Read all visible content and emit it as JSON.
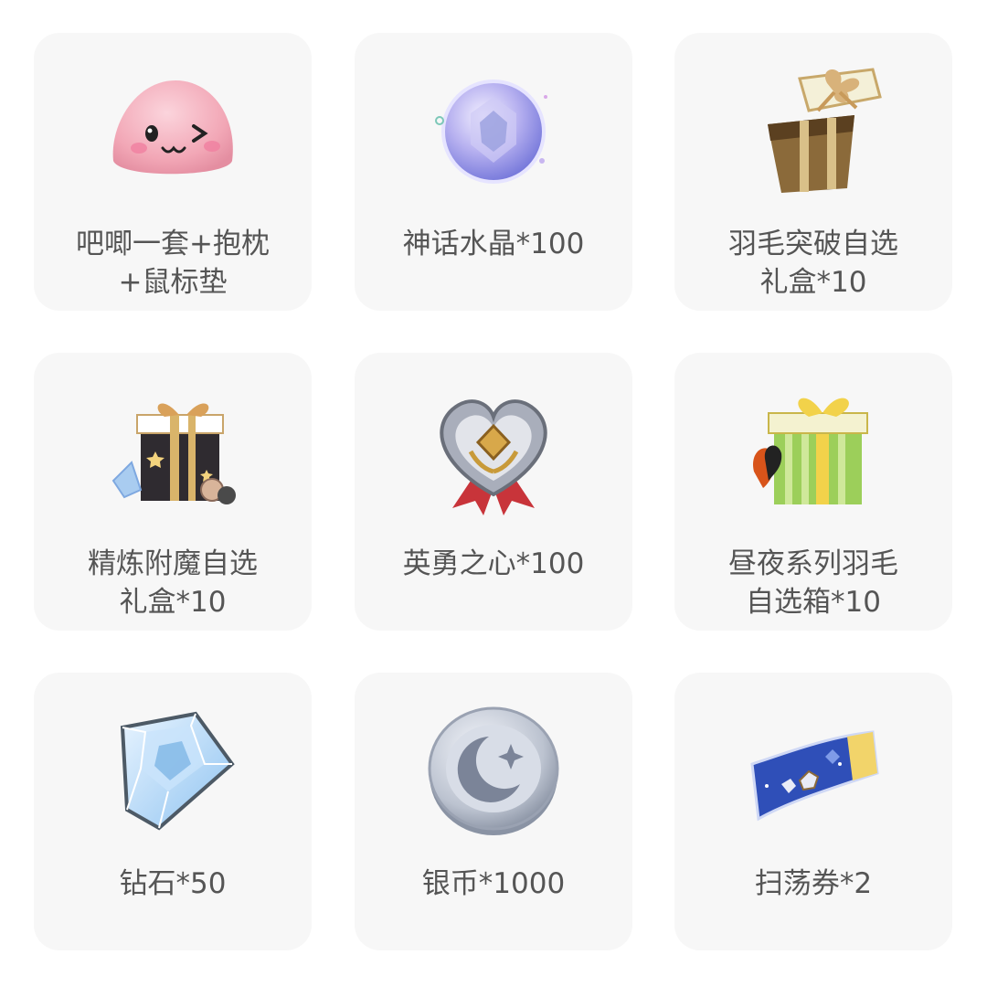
{
  "rewards": [
    {
      "icon": "pink-slime-plush-icon",
      "lines": [
        "吧唧一套+抱枕",
        "+鼠标垫"
      ]
    },
    {
      "icon": "myth-crystal-icon",
      "lines": [
        "神话水晶*100"
      ]
    },
    {
      "icon": "feather-gift-box-icon",
      "lines": [
        "羽毛突破自选",
        "礼盒*10"
      ]
    },
    {
      "icon": "enchant-gift-box-icon",
      "lines": [
        "精炼附魔自选",
        "礼盒*10"
      ]
    },
    {
      "icon": "brave-heart-medal-icon",
      "lines": [
        "英勇之心*100"
      ]
    },
    {
      "icon": "day-night-feather-box-icon",
      "lines": [
        "昼夜系列羽毛",
        "自选箱*10"
      ]
    },
    {
      "icon": "diamond-icon",
      "lines": [
        "钻石*50"
      ]
    },
    {
      "icon": "silver-coin-icon",
      "lines": [
        "银币*1000"
      ]
    },
    {
      "icon": "sweep-ticket-icon",
      "lines": [
        "扫荡券*2"
      ]
    }
  ],
  "colors": {
    "card_bg": "#f7f7f7",
    "label_text": "#555555"
  }
}
